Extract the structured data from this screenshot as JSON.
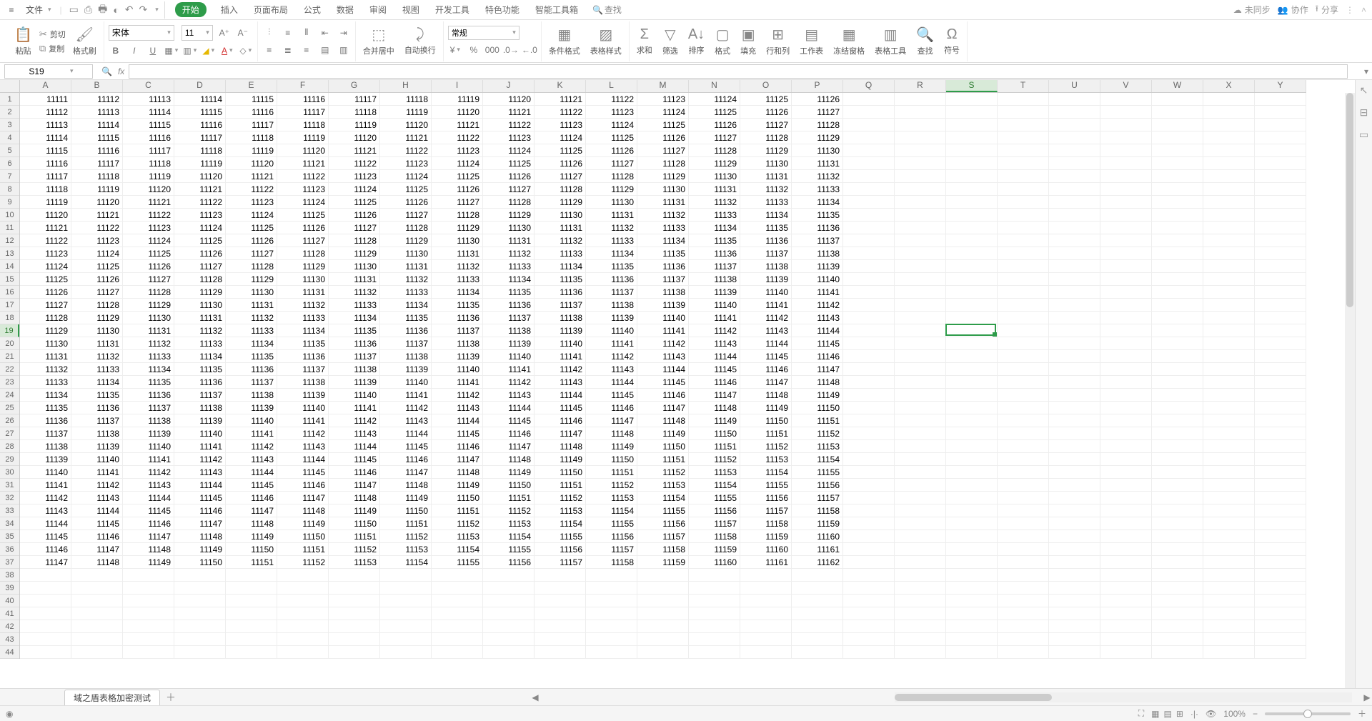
{
  "menubar": {
    "file_label": "文件",
    "tabs": [
      "开始",
      "插入",
      "页面布局",
      "公式",
      "数据",
      "审阅",
      "视图",
      "开发工具",
      "特色功能",
      "智能工具箱"
    ],
    "active_tab_index": 0,
    "search_label": "查找",
    "sync_label": "未同步",
    "collab_label": "协作",
    "share_label": "分享"
  },
  "ribbon": {
    "paste": "粘贴",
    "cut": "剪切",
    "copy": "复制",
    "format_painter": "格式刷",
    "font_name": "宋体",
    "font_size": "11",
    "merge_center": "合并居中",
    "wrap_text": "自动换行",
    "number_format": "常规",
    "cond_format": "条件格式",
    "table_style": "表格样式",
    "sum": "求和",
    "filter": "筛选",
    "sort": "排序",
    "format": "格式",
    "fill": "填充",
    "row_col": "行和列",
    "worksheet": "工作表",
    "freeze": "冻结窗格",
    "table_tools": "表格工具",
    "find": "查找",
    "symbol": "符号"
  },
  "fxbar": {
    "name_box": "S19",
    "formula": ""
  },
  "grid": {
    "columns": [
      "A",
      "B",
      "C",
      "D",
      "E",
      "F",
      "G",
      "H",
      "I",
      "J",
      "K",
      "L",
      "M",
      "N",
      "O",
      "P",
      "Q",
      "R",
      "S",
      "T",
      "U",
      "V",
      "W",
      "X",
      "Y"
    ],
    "total_visible_rows": 44,
    "data_rows": 37,
    "data_cols": 16,
    "base_value": 11111,
    "active_cell": {
      "col": "S",
      "row": 19,
      "col_index": 18,
      "row_index": 18
    }
  },
  "sheet_bar": {
    "active_sheet": "域之盾表格加密测试"
  },
  "status": {
    "zoom": "100%"
  }
}
